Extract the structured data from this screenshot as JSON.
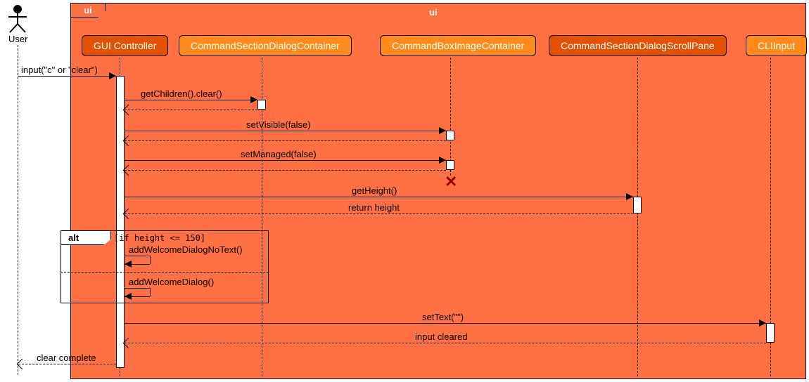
{
  "chart_data": {
    "type": "sequence-diagram",
    "frame": "ui",
    "actors": [
      {
        "id": "User",
        "label": "User",
        "kind": "actor"
      },
      {
        "id": "GUI",
        "label": "GUI Controller",
        "kind": "participant",
        "color": "redorange"
      },
      {
        "id": "CSDC",
        "label": "CommandSectionDialogContainer",
        "kind": "participant",
        "color": "orange"
      },
      {
        "id": "CBIC",
        "label": "CommandBoxImageContainer",
        "kind": "participant",
        "color": "orange"
      },
      {
        "id": "CSDSP",
        "label": "CommandSectionDialogScrollPane",
        "kind": "participant",
        "color": "redorange"
      },
      {
        "id": "CLI",
        "label": "CLIInput",
        "kind": "participant",
        "color": "orange"
      }
    ],
    "messages": [
      {
        "from": "User",
        "to": "GUI",
        "label": "input(\"c\" or \"clear\")",
        "type": "sync"
      },
      {
        "from": "GUI",
        "to": "CSDC",
        "label": "getChildren().clear()",
        "type": "sync"
      },
      {
        "from": "CSDC",
        "to": "GUI",
        "label": "",
        "type": "return"
      },
      {
        "from": "GUI",
        "to": "CBIC",
        "label": "setVisible(false)",
        "type": "sync"
      },
      {
        "from": "CBIC",
        "to": "GUI",
        "label": "",
        "type": "return"
      },
      {
        "from": "GUI",
        "to": "CBIC",
        "label": "setManaged(false)",
        "type": "sync"
      },
      {
        "from": "CBIC",
        "to": "GUI",
        "label": "",
        "type": "return"
      },
      {
        "note": "destroy",
        "target": "CBIC"
      },
      {
        "from": "GUI",
        "to": "CSDSP",
        "label": "getHeight()",
        "type": "sync"
      },
      {
        "from": "CSDSP",
        "to": "GUI",
        "label": "return height",
        "type": "return"
      },
      {
        "frame": "alt",
        "guard": "[if height <= 150]",
        "branches": [
          {
            "self": "GUI",
            "label": "addWelcomeDialogNoText()"
          },
          {
            "self": "GUI",
            "label": "addWelcomeDialog()"
          }
        ]
      },
      {
        "from": "GUI",
        "to": "CLI",
        "label": "setText(\"\")",
        "type": "sync"
      },
      {
        "from": "CLI",
        "to": "GUI",
        "label": "input cleared",
        "type": "return"
      },
      {
        "from": "GUI",
        "to": "User",
        "label": "clear complete",
        "type": "return"
      }
    ]
  },
  "labels": {
    "frameTitle": "ui",
    "user": "User",
    "gui": "GUI Controller",
    "csdc": "CommandSectionDialogContainer",
    "cbic": "CommandBoxImageContainer",
    "csdsp": "CommandSectionDialogScrollPane",
    "cli": "CLIInput",
    "m_input": "input(\"c\" or \"clear\")",
    "m_getChildren": "getChildren().clear()",
    "m_setVisible": "setVisible(false)",
    "m_setManaged": "setManaged(false)",
    "m_getHeight": "getHeight()",
    "m_returnHeight": "return height",
    "alt": "alt",
    "guard": "[if height <= 150]",
    "m_addNoText": "addWelcomeDialogNoText()",
    "m_addWelcome": "addWelcomeDialog()",
    "m_setText": "setText(\"\")",
    "m_inputCleared": "input cleared",
    "m_clearComplete": "clear complete"
  }
}
